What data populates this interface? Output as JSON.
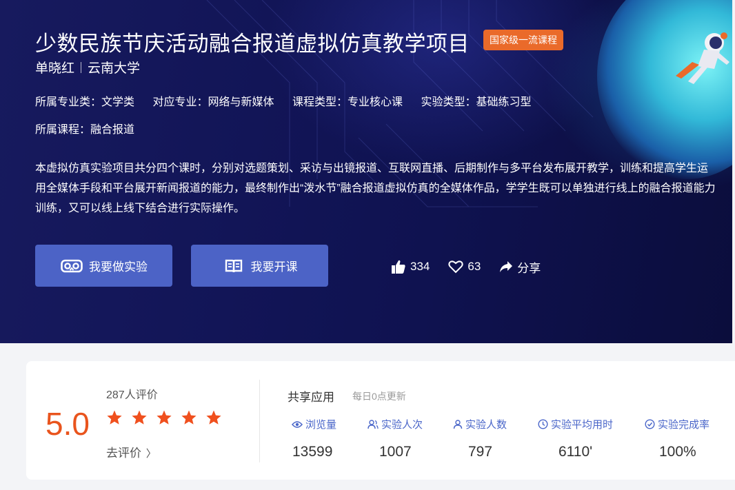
{
  "hero": {
    "title": "少数民族节庆活动融合报道虚拟仿真教学项目",
    "badge": "国家级一流课程",
    "author": "单晓红",
    "institution": "云南大学",
    "meta": [
      {
        "label": "所属专业类：",
        "value": "文学类"
      },
      {
        "label": "对应专业：",
        "value": "网络与新媒体"
      },
      {
        "label": "课程类型：",
        "value": "专业核心课"
      },
      {
        "label": "实验类型：",
        "value": "基础练习型"
      },
      {
        "label": "所属课程：",
        "value": "融合报道"
      }
    ],
    "description": "本虚拟仿真实验项目共分四个课时，分别对选题策划、采访与出镜报道、互联网直播、后期制作与多平台发布展开教学，训练和提高学生运用全媒体手段和平台展开新闻报道的能力，最终制作出“泼水节”融合报道虚拟仿真的全媒体作品，学学生既可以单独进行线上的融合报道能力训练，又可以线上线下结合进行实际操作。",
    "buttons": {
      "experiment": "我要做实验",
      "open_course": "我要开课"
    },
    "social": {
      "likes": "334",
      "favorites": "63",
      "share": "分享"
    }
  },
  "rating": {
    "score": "5.0",
    "count_text": "287人评价",
    "stars": 5,
    "go_review": "去评价",
    "go_review_chevron": "〉"
  },
  "shared": {
    "title": "共享应用",
    "subtitle": "每日0点更新",
    "stats": [
      {
        "label": "浏览量",
        "value": "13599",
        "icon": "eye-icon"
      },
      {
        "label": "实验人次",
        "value": "1007",
        "icon": "users-icon"
      },
      {
        "label": "实验人数",
        "value": "797",
        "icon": "user-icon"
      },
      {
        "label": "实验平均用时",
        "value": "6110'",
        "icon": "clock-icon"
      },
      {
        "label": "实验完成率",
        "value": "100%",
        "icon": "check-circle-icon"
      }
    ]
  },
  "colors": {
    "hero_bg": "#121557",
    "badge": "#ea6a2a",
    "button": "#4c63c6",
    "score": "#e9541d",
    "star": "#f0501e",
    "stat_label": "#4a66c9"
  }
}
